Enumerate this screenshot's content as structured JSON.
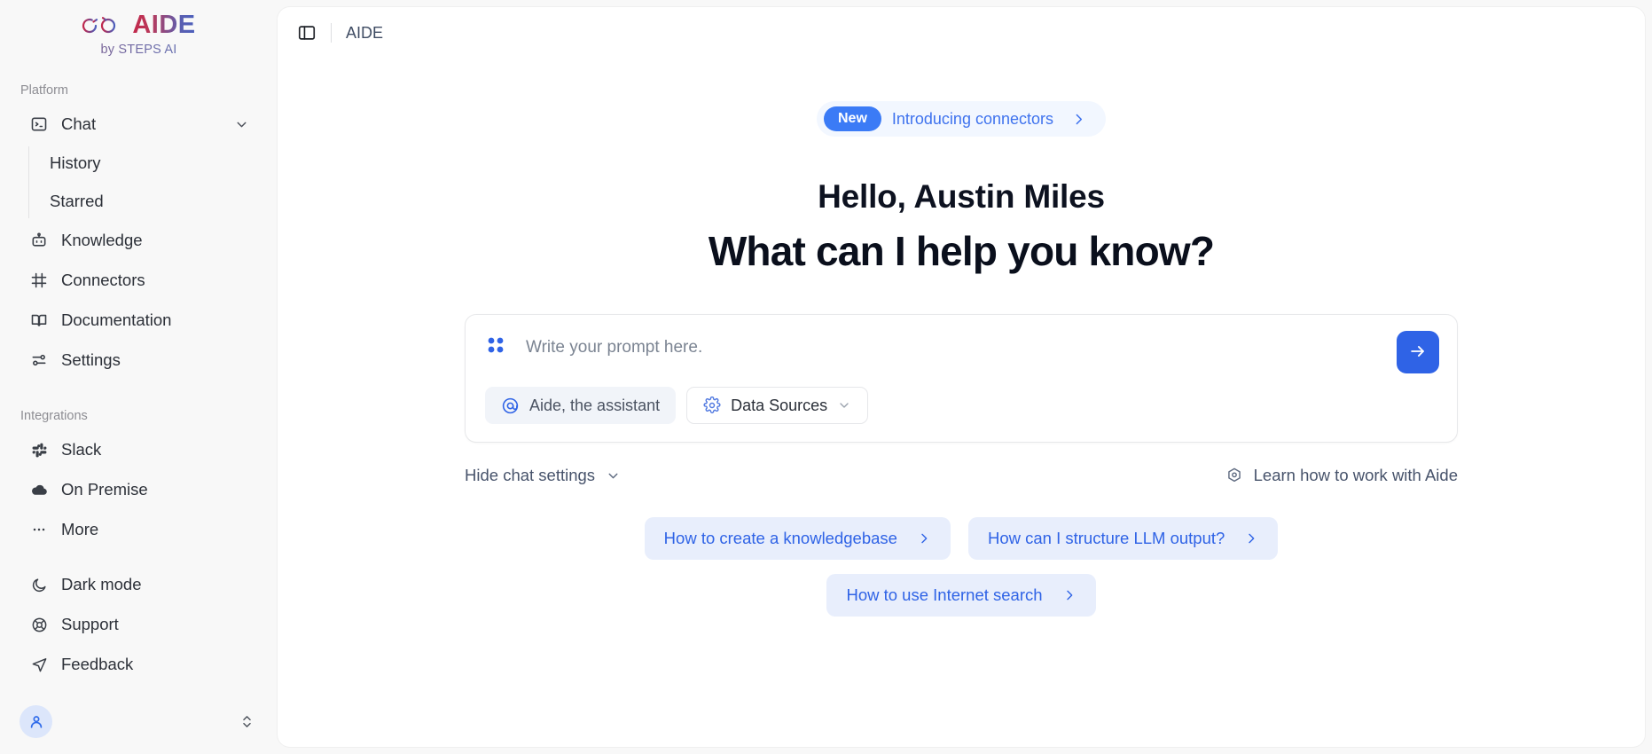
{
  "brand": {
    "name": "AIDE",
    "tagline": "by STEPS AI",
    "logo_icon": "infinity-rings-icon",
    "gradient_start": "#c2274a",
    "gradient_end": "#4a5fbd"
  },
  "sidebar": {
    "sections": [
      {
        "label": "Platform",
        "items": [
          {
            "label": "Chat",
            "icon": "terminal-icon",
            "expandable": true,
            "chevron": "chevron-down-icon"
          },
          {
            "label": "Knowledge",
            "icon": "bot-icon"
          },
          {
            "label": "Connectors",
            "icon": "grid-hash-icon"
          },
          {
            "label": "Documentation",
            "icon": "book-open-icon"
          },
          {
            "label": "Settings",
            "icon": "sliders-icon"
          }
        ],
        "subitems": [
          {
            "label": "History"
          },
          {
            "label": "Starred"
          }
        ]
      },
      {
        "label": "Integrations",
        "items": [
          {
            "label": "Slack",
            "icon": "slack-icon"
          },
          {
            "label": "On Premise",
            "icon": "cloud-icon"
          },
          {
            "label": "More",
            "icon": "ellipsis-icon"
          }
        ]
      }
    ],
    "utility_items": [
      {
        "label": "Dark mode",
        "icon": "moon-icon"
      },
      {
        "label": "Support",
        "icon": "lifebuoy-icon"
      },
      {
        "label": "Feedback",
        "icon": "send-plane-icon"
      }
    ],
    "profile": {
      "avatar_icon": "user-icon",
      "selector_icon": "chevron-up-down-icon",
      "avatar_bg": "#dce6fb",
      "avatar_fg": "#2f6bea"
    }
  },
  "topbar": {
    "toggle_icon": "panel-left-icon",
    "breadcrumb": "AIDE"
  },
  "banner": {
    "badge": "New",
    "text": "Introducing connectors",
    "chevron_icon": "chevron-right-icon",
    "accent": "#3b7bf6",
    "background": "#f2f7ff"
  },
  "hero": {
    "greeting": "Hello, Austin Miles",
    "question": "What can I help you know?"
  },
  "composer": {
    "leading_icon": "four-dots-icon",
    "placeholder": "Write your prompt here.",
    "value": "",
    "send_icon": "arrow-right-icon",
    "send_color": "#2f63e6",
    "chips": [
      {
        "label": "Aide, the assistant",
        "icon": "at-sign-icon"
      },
      {
        "label": "Data Sources",
        "icon": "gear-icon",
        "chevron": "chevron-down-icon"
      }
    ]
  },
  "settings_row": {
    "hide_label": "Hide chat settings",
    "hide_chevron": "chevron-down-icon",
    "learn_label": "Learn how to work with Aide",
    "learn_icon": "hexagon-target-icon"
  },
  "suggestions": {
    "row1": [
      {
        "label": "How to create a knowledgebase",
        "chevron": "chevron-right-icon"
      },
      {
        "label": "How can I structure LLM output?",
        "chevron": "chevron-right-icon"
      }
    ],
    "row2": [
      {
        "label": "How to use Internet search",
        "chevron": "chevron-right-icon"
      }
    ]
  }
}
